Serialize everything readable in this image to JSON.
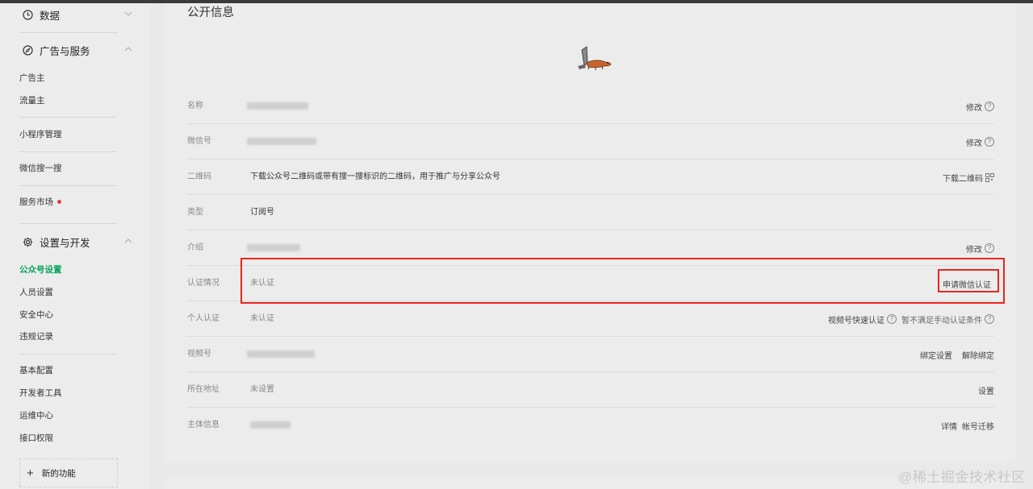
{
  "sidebar": {
    "groups": [
      {
        "label": "数据",
        "icon": "clock-icon"
      },
      {
        "label": "广告与服务",
        "icon": "compass-icon"
      },
      {
        "label": "设置与开发",
        "icon": "gear-icon"
      }
    ],
    "ads_items": [
      "广告主",
      "流量主"
    ],
    "mini_program": "小程序管理",
    "wechat_search": "微信搜一搜",
    "service_market": "服务市场",
    "settings_items": [
      "公众号设置",
      "人员设置",
      "安全中心",
      "违规记录"
    ],
    "dev_items": [
      "基本配置",
      "开发者工具",
      "运维中心",
      "接口权限"
    ],
    "new_feature": "新的功能",
    "active_item": "公众号设置",
    "accent_color": "#07a35a"
  },
  "main": {
    "section_title": "公开信息",
    "rows": [
      {
        "label": "名称",
        "value": "",
        "action": "修改"
      },
      {
        "label": "微信号",
        "value": "",
        "action": "修改"
      },
      {
        "label": "二维码",
        "value": "下载公众号二维码或带有搜一搜标识的二维码，用于推广与分享公众号",
        "action": "下载二维码"
      },
      {
        "label": "类型",
        "value": "订阅号",
        "action": ""
      },
      {
        "label": "介绍",
        "value": "",
        "action": "修改"
      },
      {
        "label": "认证情况",
        "value": "未认证",
        "action": "申请微信认证"
      },
      {
        "label": "个人认证",
        "value": "未认证",
        "action": "视频号快速认证",
        "action2": "暂不满足手动认证条件"
      },
      {
        "label": "视频号",
        "value": "",
        "action": "绑定设置",
        "action2": "解除绑定"
      },
      {
        "label": "所在地址",
        "value": "未设置",
        "action": "设置"
      },
      {
        "label": "主体信息",
        "value": "",
        "action": "详情",
        "action2": "帐号迁移"
      }
    ]
  },
  "watermark": "@稀土掘金技术社区",
  "highlight_color": "#e8261e"
}
